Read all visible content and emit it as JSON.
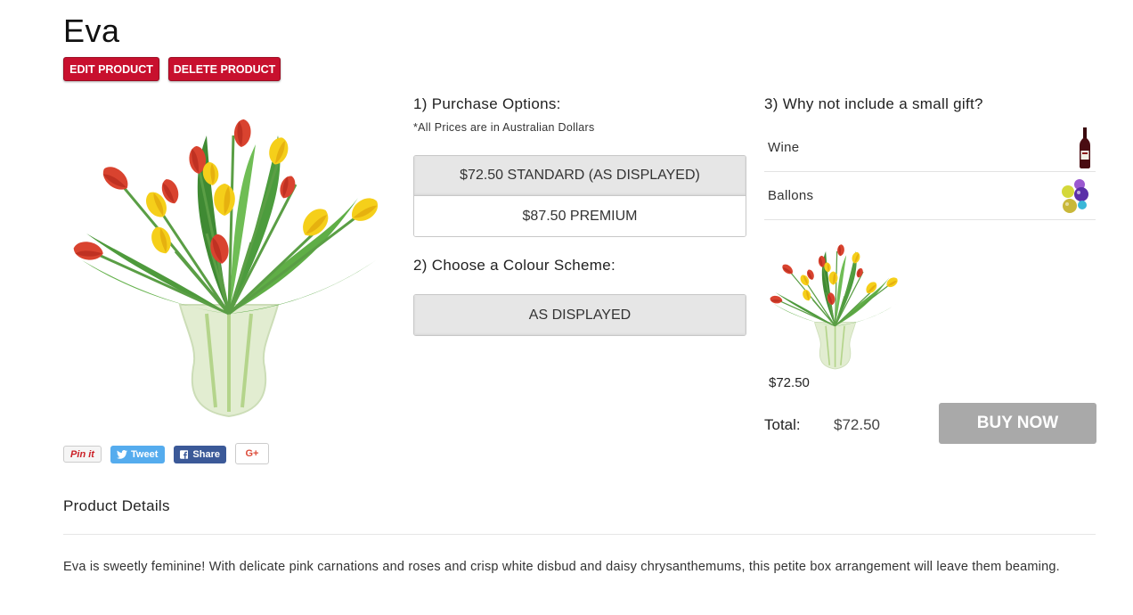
{
  "product": {
    "title": "Eva",
    "edit_label": "EDIT PRODUCT",
    "delete_label": "DELETE PRODUCT"
  },
  "share": {
    "pinit": "Pin it",
    "tweet": "Tweet",
    "share": "Share",
    "gplus": "G+"
  },
  "purchase": {
    "heading": "1) Purchase Options:",
    "note": "*All Prices are in Australian Dollars",
    "options": [
      {
        "label": "$72.50 STANDARD (AS DISPLAYED)",
        "selected": true
      },
      {
        "label": "$87.50 PREMIUM",
        "selected": false
      }
    ]
  },
  "colour": {
    "heading": "2) Choose a Colour Scheme:",
    "options": [
      {
        "label": "AS DISPLAYED",
        "selected": true
      }
    ]
  },
  "gifts": {
    "heading": "3) Why not include a small gift?",
    "items": [
      {
        "label": "Wine",
        "icon": "wine-bottle-icon"
      },
      {
        "label": "Ballons",
        "icon": "balloons-icon"
      }
    ]
  },
  "summary": {
    "thumb_price": "$72.50",
    "total_label": "Total:",
    "total_value": "$72.50",
    "buy_label": "BUY NOW"
  },
  "details": {
    "heading": "Product Details",
    "description": "Eva is sweetly feminine! With delicate pink carnations and roses and crisp white disbud and daisy chrysanthemums, this petite box arrangement will leave them beaming."
  },
  "colors": {
    "admin_red": "#c8102e",
    "buy_grey": "#a9a9a9",
    "tweet_blue": "#55acee",
    "facebook_blue": "#3b5998"
  }
}
